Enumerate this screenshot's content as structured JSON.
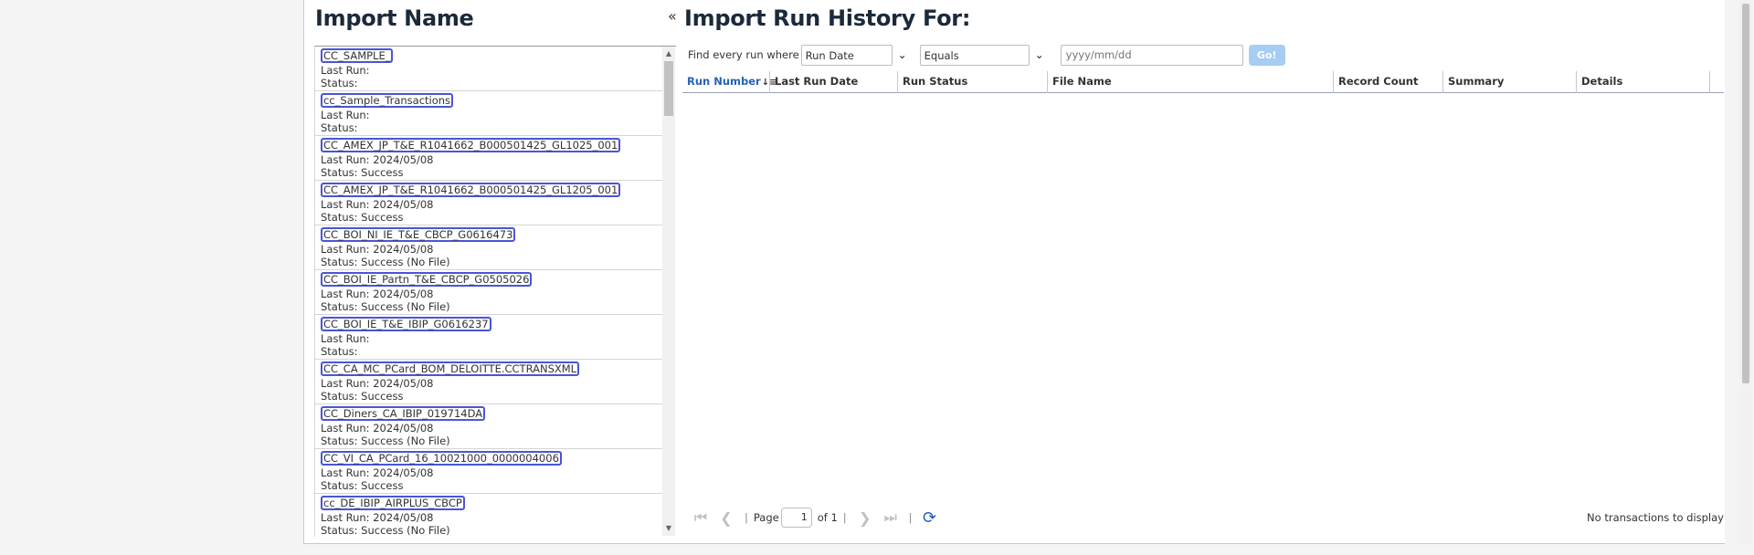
{
  "left": {
    "title": "Import Name",
    "collapse_icon": "«",
    "items": [
      {
        "name": "CC_SAMPLE_",
        "last_run": "Last Run:",
        "status": "Status:"
      },
      {
        "name": "cc_Sample_Transactions",
        "last_run": "Last Run:",
        "status": "Status:"
      },
      {
        "name": "CC_AMEX_JP_T&E_R1041662_B000501425_GL1025_001",
        "last_run": "Last Run: 2024/05/08",
        "status": "Status: Success"
      },
      {
        "name": "CC_AMEX_JP_T&E_R1041662_B000501425_GL1205_001",
        "last_run": "Last Run: 2024/05/08",
        "status": "Status: Success"
      },
      {
        "name": "CC_BOI_NI_IE_T&E_CBCP_G0616473",
        "last_run": "Last Run: 2024/05/08",
        "status": "Status: Success (No File)"
      },
      {
        "name": "CC_BOI_IE_Partn_T&E_CBCP_G0505026",
        "last_run": "Last Run: 2024/05/08",
        "status": "Status: Success (No File)"
      },
      {
        "name": "CC_BOI_IE_T&E_IBIP_G0616237",
        "last_run": "Last Run:",
        "status": "Status:"
      },
      {
        "name": "CC_CA_MC_PCard_BOM_DELOITTE.CCTRANSXML",
        "last_run": "Last Run: 2024/05/08",
        "status": "Status: Success"
      },
      {
        "name": "CC_Diners_CA_IBIP_019714DA",
        "last_run": "Last Run: 2024/05/08",
        "status": "Status: Success (No File)"
      },
      {
        "name": "CC_VI_CA_PCard_16_10021000_0000004006",
        "last_run": "Last Run: 2024/05/08",
        "status": "Status: Success"
      },
      {
        "name": "cc_DE_IBIP_AIRPLUS_CBCP",
        "last_run": "Last Run: 2024/05/08",
        "status": "Status: Success (No File)"
      }
    ]
  },
  "right": {
    "title": "Import Run History For:",
    "filter": {
      "label": "Find every run where",
      "field_value": "Run Date",
      "operator_value": "Equals",
      "date_placeholder": "yyyy/mm/dd",
      "go_label": "Go!"
    },
    "columns": [
      {
        "label": "Run Number",
        "sorted": true
      },
      {
        "label": "Last Run Date"
      },
      {
        "label": "Run Status"
      },
      {
        "label": "File Name"
      },
      {
        "label": "Record Count"
      },
      {
        "label": "Summary"
      },
      {
        "label": "Details"
      }
    ],
    "pager": {
      "page_label": "Page",
      "page_value": "1",
      "of_label": "of 1",
      "empty_message": "No transactions to display"
    }
  },
  "colors": {
    "accent": "#2563b6",
    "item_outline": "#4a55d6",
    "go_button": "#a6cdf3",
    "title": "#1b2a3a"
  }
}
